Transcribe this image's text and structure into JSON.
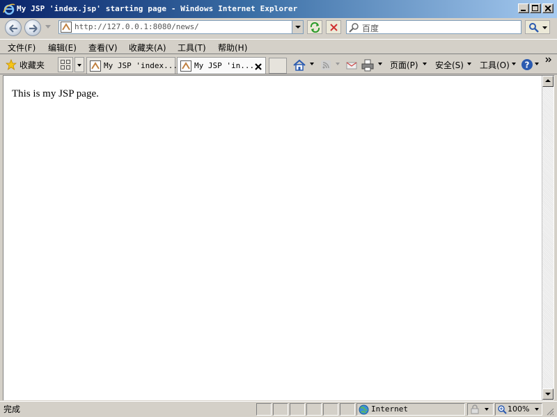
{
  "window": {
    "title": "My JSP 'index.jsp' starting page - Windows Internet Explorer"
  },
  "address_bar": {
    "url": "http://127.0.0.1:8080/news/",
    "search_placeholder": "百度"
  },
  "menu": {
    "items": [
      "文件(F)",
      "编辑(E)",
      "查看(V)",
      "收藏夹(A)",
      "工具(T)",
      "帮助(H)"
    ]
  },
  "favorites": {
    "label": "收藏夹"
  },
  "tabs": [
    {
      "title": "My JSP 'index...",
      "active": false
    },
    {
      "title": "My JSP 'in...",
      "active": true
    }
  ],
  "commands": {
    "page": "页面(P)",
    "safety": "安全(S)",
    "tools": "工具(O)"
  },
  "content": {
    "text": "This is my JSP page."
  },
  "status": {
    "left": "完成",
    "zone": "Internet",
    "zoom": "100%"
  },
  "colors": {
    "title_bar_start": "#0a246a",
    "title_bar_end": "#a6caf0",
    "chrome": "#d4d0c8"
  }
}
